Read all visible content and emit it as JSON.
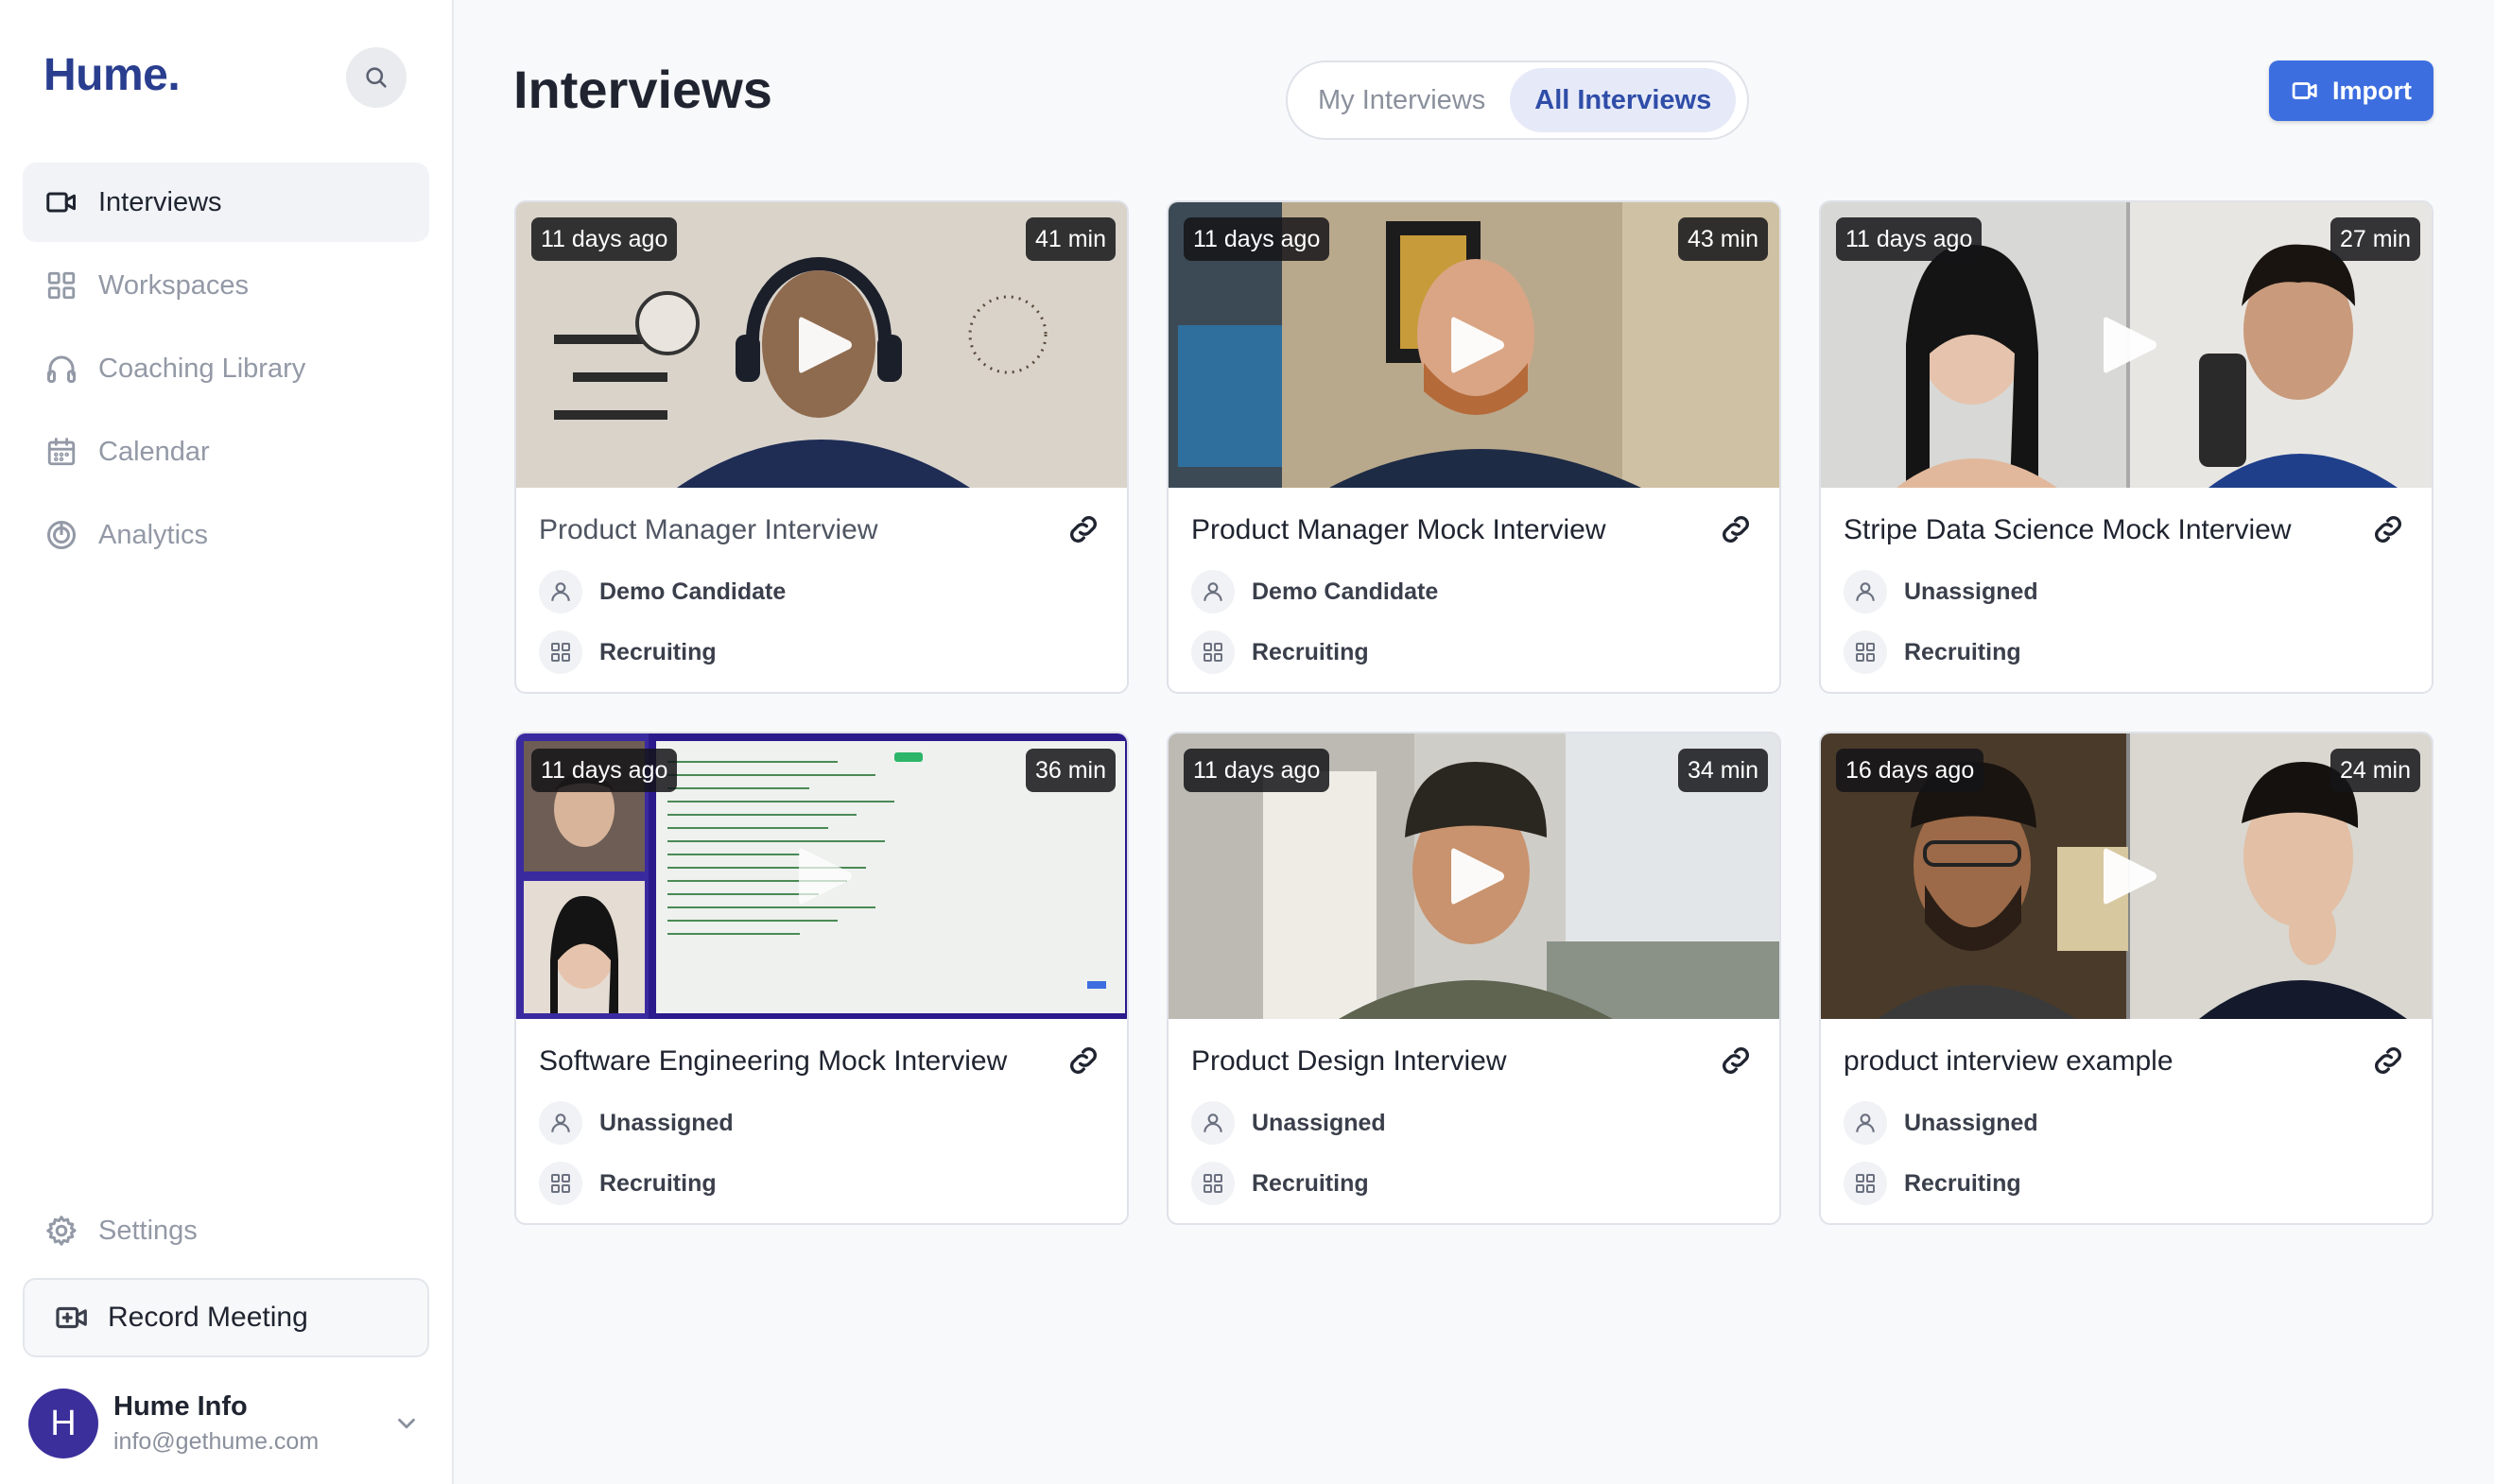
{
  "brand": {
    "logo": "Hume."
  },
  "sidebar": {
    "nav": [
      {
        "label": "Interviews",
        "icon": "video-camera-icon",
        "active": true
      },
      {
        "label": "Workspaces",
        "icon": "grid-icon",
        "active": false
      },
      {
        "label": "Coaching Library",
        "icon": "headphones-icon",
        "active": false
      },
      {
        "label": "Calendar",
        "icon": "calendar-icon",
        "active": false
      },
      {
        "label": "Analytics",
        "icon": "target-icon",
        "active": false
      }
    ],
    "settings_label": "Settings",
    "record_label": "Record Meeting",
    "user": {
      "initial": "H",
      "name": "Hume Info",
      "email": "info@gethume.com"
    }
  },
  "header": {
    "title": "Interviews",
    "tabs": [
      {
        "label": "My Interviews",
        "active": false
      },
      {
        "label": "All Interviews",
        "active": true
      }
    ],
    "import_label": "Import"
  },
  "interviews": [
    {
      "age": "11 days ago",
      "duration": "41 min",
      "title": "Product Manager Interview",
      "candidate": "Demo Candidate",
      "workspace": "Recruiting"
    },
    {
      "age": "11 days ago",
      "duration": "43 min",
      "title": "Product Manager Mock Interview",
      "candidate": "Demo Candidate",
      "workspace": "Recruiting"
    },
    {
      "age": "11 days ago",
      "duration": "27 min",
      "title": "Stripe Data Science Mock Interview",
      "candidate": "Unassigned",
      "workspace": "Recruiting"
    },
    {
      "age": "11 days ago",
      "duration": "36 min",
      "title": "Software Engineering Mock Interview",
      "candidate": "Unassigned",
      "workspace": "Recruiting"
    },
    {
      "age": "11 days ago",
      "duration": "34 min",
      "title": "Product Design Interview",
      "candidate": "Unassigned",
      "workspace": "Recruiting"
    },
    {
      "age": "16 days ago",
      "duration": "24 min",
      "title": "product interview example",
      "candidate": "Unassigned",
      "workspace": "Recruiting"
    }
  ],
  "colors": {
    "brand": "#2a3e8f",
    "accent": "#3d6ee0",
    "active_tab_text": "#2f4da8"
  }
}
